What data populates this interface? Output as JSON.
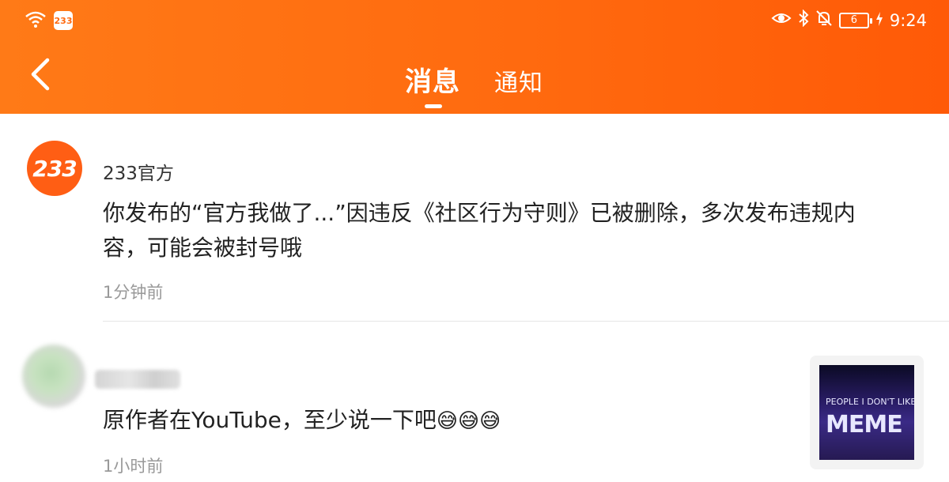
{
  "status_bar": {
    "app_badge": "233",
    "battery": "6",
    "time": "9:24"
  },
  "header": {
    "back_icon": "chevron-left-icon",
    "tabs": [
      {
        "label": "消息",
        "active": true
      },
      {
        "label": "通知",
        "active": false
      }
    ]
  },
  "messages": [
    {
      "sender": "233官方",
      "avatar_text": "233",
      "content": "你发布的“官方我做了...”因违反《社区行为守则》已被删除，多次发布违规内容，可能会被封号哦",
      "time": "1分钟前"
    },
    {
      "sender": "",
      "content": "原作者在YouTube，至少说一下吧",
      "emojis": [
        "😅",
        "😅",
        "😅"
      ],
      "time": "1小时前",
      "thumbnail": {
        "line1": "PEOPLE I DON'T LIKE",
        "line2": "MEME"
      }
    }
  ],
  "colors": {
    "accent": "#ff6a10",
    "text": "#222222",
    "muted": "#999999"
  }
}
